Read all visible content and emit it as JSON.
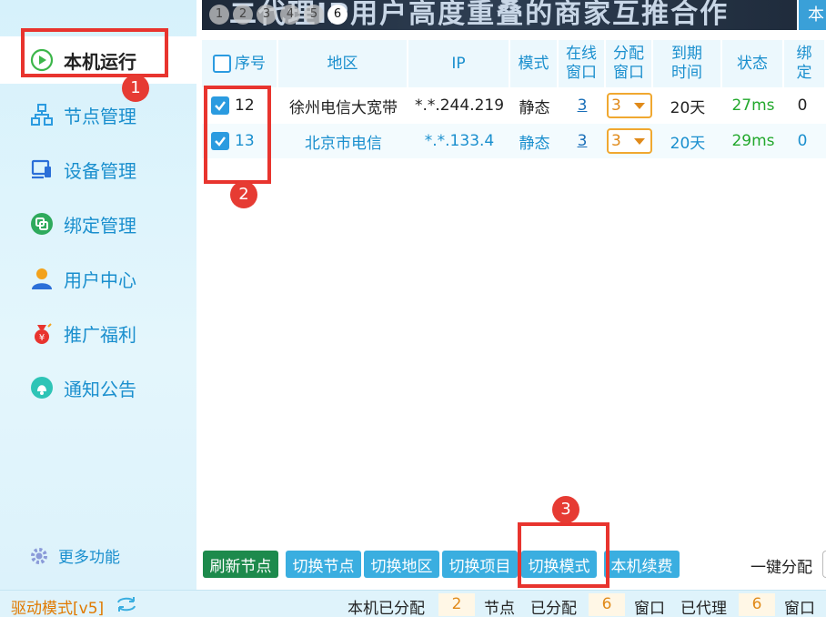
{
  "sidebar": {
    "items": [
      {
        "label": "本机运行",
        "icon": "play-icon",
        "active": true
      },
      {
        "label": "节点管理",
        "icon": "node-tree-icon"
      },
      {
        "label": "设备管理",
        "icon": "device-icon"
      },
      {
        "label": "绑定管理",
        "icon": "bind-icon"
      },
      {
        "label": "用户中心",
        "icon": "user-icon"
      },
      {
        "label": "推广福利",
        "icon": "gift-bag-icon"
      },
      {
        "label": "通知公告",
        "icon": "bell-icon"
      }
    ],
    "more": "更多功能"
  },
  "banner": {
    "text": "二代理IP用户高度重叠的商家互推合作",
    "dots": [
      "1",
      "2",
      "3",
      "4",
      "5",
      "6"
    ],
    "active_dot": 5,
    "right_button": "本"
  },
  "table": {
    "headers": {
      "index": "序号",
      "region": "地区",
      "ip": "IP",
      "mode": "模式",
      "online_1": "在线",
      "online_2": "窗口",
      "assign_1": "分配",
      "assign_2": "窗口",
      "expire_1": "到期",
      "expire_2": "时间",
      "status": "状态",
      "bind_1": "绑",
      "bind_2": "定"
    },
    "rows": [
      {
        "index": "12",
        "region": "徐州电信大宽带",
        "ip": "*.*.244.219",
        "mode": "静态",
        "online": "3",
        "assign": "3",
        "expire": "20天",
        "status": "27ms",
        "bind": "0"
      },
      {
        "index": "13",
        "region": "北京市电信",
        "ip": "*.*.133.4",
        "mode": "静态",
        "online": "3",
        "assign": "3",
        "expire": "20天",
        "status": "29ms",
        "bind": "0"
      }
    ]
  },
  "actions": {
    "refresh": "刷新节点",
    "switch_node": "切换节点",
    "switch_region": "切换地区",
    "switch_project": "切换项目",
    "switch_mode": "切换模式",
    "renew": "本机续费",
    "one_key": "一键分配"
  },
  "status_bar": {
    "drive_mode": "驱动模式[v5]",
    "local_assigned_label": "本机已分配",
    "local_assigned_value": "2",
    "node_label": "节点",
    "assigned_label": "已分配",
    "assigned_value": "6",
    "window_label": "窗口",
    "proxied_label": "已代理",
    "proxied_value": "6",
    "window_label_2": "窗口"
  },
  "annotations": [
    "1",
    "2",
    "3"
  ],
  "colors": {
    "accent": "#1a8fce",
    "annotation_red": "#e8342e",
    "green_status": "#22a82c",
    "orange": "#e08a1a",
    "refresh_green": "#1d8a4c"
  }
}
